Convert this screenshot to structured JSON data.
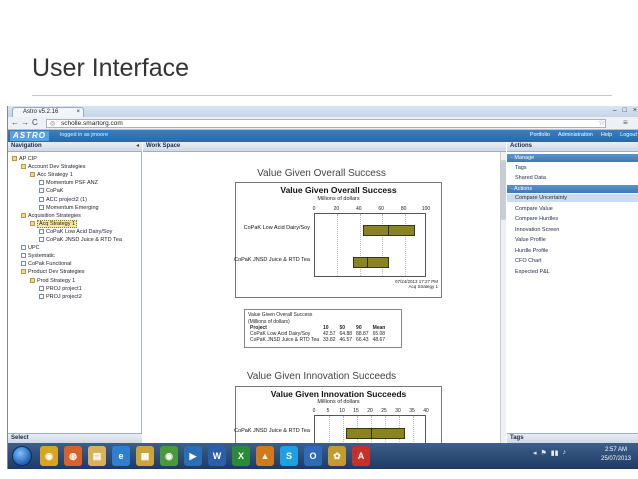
{
  "slide": {
    "title": "User Interface"
  },
  "browser": {
    "tab_title": "Astro v5.2.16",
    "tab_close": "×",
    "window_controls": [
      "–",
      "□",
      "×"
    ],
    "url": "scholle.smartorg.com",
    "nav": {
      "back": "←",
      "forward": "→",
      "reload": "C"
    }
  },
  "app": {
    "logo": "ASTRO",
    "logged_in": "logged in as jmoore",
    "top_menu": [
      "Portfolio",
      "Administration",
      "Help",
      "Logout"
    ]
  },
  "navigation": {
    "header": "Navigation",
    "collapse": "◂",
    "items": [
      {
        "label": "AP CIP",
        "indent": 0,
        "icon": "fold"
      },
      {
        "label": "Account Dev Strategies",
        "indent": 1,
        "icon": "fold"
      },
      {
        "label": "Acc Strategy 1",
        "indent": 2,
        "icon": "fold"
      },
      {
        "label": "Momentum PSF ANZ",
        "indent": 3,
        "icon": "doc"
      },
      {
        "label": "CoPaK",
        "indent": 3,
        "icon": "doc"
      },
      {
        "label": "ACC project2 (1)",
        "indent": 3,
        "icon": "doc"
      },
      {
        "label": "Momentum Emerging",
        "indent": 3,
        "icon": "doc"
      },
      {
        "label": "Acquisition Strategies",
        "indent": 1,
        "icon": "fold"
      },
      {
        "label": "Acq Strategy 1",
        "indent": 2,
        "icon": "fold",
        "selected": true
      },
      {
        "label": "CoPaK Low Acid Dairy/Soy",
        "indent": 3,
        "icon": "doc"
      },
      {
        "label": "CoPaK JNSD Juice & RTD Tea",
        "indent": 3,
        "icon": "doc"
      },
      {
        "label": "UPC",
        "indent": 1,
        "icon": "doc"
      },
      {
        "label": "Systematic",
        "indent": 1,
        "icon": "doc"
      },
      {
        "label": "CoPak Functional",
        "indent": 1,
        "icon": "doc"
      },
      {
        "label": "Product Dev Strategies",
        "indent": 1,
        "icon": "fold"
      },
      {
        "label": "Prod Strategy 1",
        "indent": 2,
        "icon": "fold"
      },
      {
        "label": "PROJ project1",
        "indent": 3,
        "icon": "doc"
      },
      {
        "label": "PROJ project2",
        "indent": 3,
        "icon": "doc"
      }
    ],
    "select_header": "Select"
  },
  "workspace": {
    "header": "Work Space",
    "heading1": "Value Given Overall Success",
    "heading2": "Value Given Innovation Succeeds",
    "stats": {
      "title": "Value Given Overall Success",
      "subtitle": "(Millions of dollars)",
      "columns": [
        "Project",
        "10",
        "50",
        "90",
        "Mean"
      ],
      "rows": [
        [
          "CoPaK Low Acid Dairy/Soy",
          "42.57",
          "64.88",
          "88.87",
          "65.08"
        ],
        [
          "CoPaK JNSD Juice & RTD Tea",
          "33.82",
          "46.57",
          "66.43",
          "48.67"
        ]
      ]
    }
  },
  "chart_data": [
    {
      "type": "bar",
      "title": "Value Given Overall Success",
      "xlabel": "Millions of dollars",
      "xlim": [
        0,
        100
      ],
      "xticks": [
        "0",
        "20",
        "40",
        "60",
        "80",
        "100"
      ],
      "categories": [
        "CoPaK Low Acid Dairy/Soy",
        "CoPaK JNSD Juice & RTD Tea"
      ],
      "series": [
        {
          "low": [
            42.57,
            33.82
          ],
          "median": [
            64.88,
            46.57
          ],
          "high": [
            88.87,
            66.43
          ]
        }
      ],
      "stamp": [
        "07/24/2013 17:27 PM",
        "Acq Strategy 1"
      ]
    },
    {
      "type": "bar",
      "title": "Value Given Innovation Succeeds",
      "xlabel": "Millions of dollars",
      "xlim": [
        0,
        40
      ],
      "xticks": [
        "0",
        "5",
        "10",
        "15",
        "20",
        "25",
        "30",
        "35",
        "40"
      ],
      "categories": [
        "CoPaK JNSD Juice & RTD Tea"
      ],
      "series": [
        {
          "low": [
            11
          ],
          "median": [
            20
          ],
          "high": [
            32
          ]
        }
      ]
    }
  ],
  "actions": {
    "header": "Actions",
    "sections": [
      {
        "label": "-  Manage",
        "items": [
          "Tags",
          "Shared Data"
        ]
      },
      {
        "label": "-  Actions",
        "items": [
          "Compare Uncertainty",
          "Compare Value",
          "Compare Hurdles",
          "Innovation Screen",
          "Value Profile",
          "Hurdle Profile",
          "CFO Chart",
          "Expected P&L"
        ]
      }
    ],
    "tags_header": "Tags"
  },
  "taskbar": {
    "apps": [
      {
        "name": "chrome-icon",
        "color": "#d9a520",
        "glyph": "◉"
      },
      {
        "name": "firefox-icon",
        "color": "#d9622b",
        "glyph": "◍"
      },
      {
        "name": "explorer-icon",
        "color": "#d8b25a",
        "glyph": "▤"
      },
      {
        "name": "ie-icon",
        "color": "#2f7fd0",
        "glyph": "e"
      },
      {
        "name": "notes-icon",
        "color": "#caa53a",
        "glyph": "▦"
      },
      {
        "name": "chrome2-icon",
        "color": "#4a9a3a",
        "glyph": "◉"
      },
      {
        "name": "media-icon",
        "color": "#2a6fb5",
        "glyph": "▶"
      },
      {
        "name": "word-icon",
        "color": "#2b5fa8",
        "glyph": "W"
      },
      {
        "name": "excel-icon",
        "color": "#2a8a3a",
        "glyph": "X"
      },
      {
        "name": "vlc-icon",
        "color": "#d07a1a",
        "glyph": "▲"
      },
      {
        "name": "skype-icon",
        "color": "#1fa0e0",
        "glyph": "S"
      },
      {
        "name": "outlook-icon",
        "color": "#2f6ab8",
        "glyph": "O"
      },
      {
        "name": "app-icon",
        "color": "#c59a30",
        "glyph": "✿"
      },
      {
        "name": "pdf-icon",
        "color": "#c8302a",
        "glyph": "A"
      }
    ],
    "tray": [
      "◂",
      "⚑",
      "▮▮",
      "♪"
    ],
    "time": "2:57 AM",
    "date": "25/07/2013"
  }
}
